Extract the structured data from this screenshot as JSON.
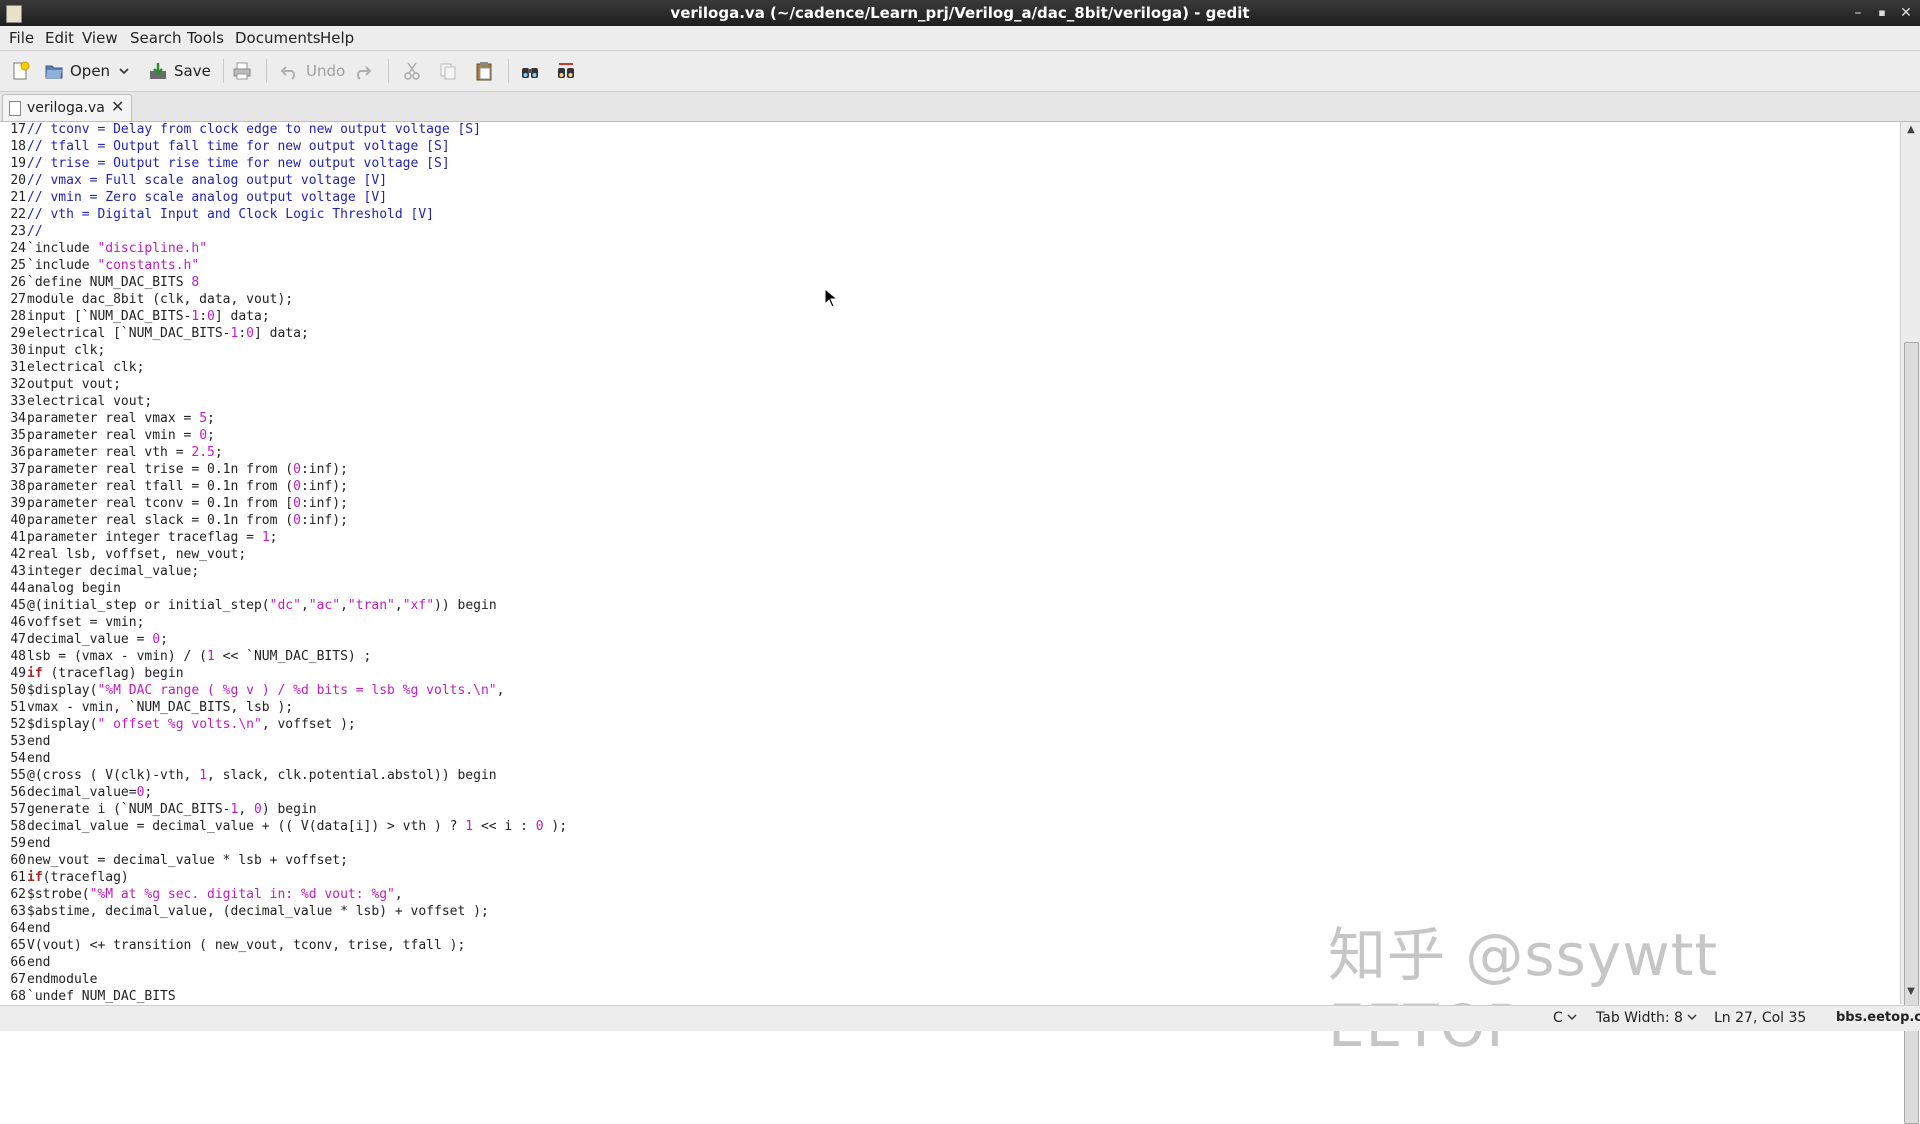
{
  "window": {
    "title": "veriloga.va (~/cadence/Learn_prj/Verilog_a/dac_8bit/veriloga) - gedit"
  },
  "menu": [
    "File",
    "Edit",
    "View",
    "Search",
    "Tools",
    "Documents",
    "Help"
  ],
  "toolbar": {
    "open": "Open",
    "save": "Save",
    "undo": "Undo"
  },
  "tab": {
    "label": "veriloga.va"
  },
  "code_lines": [
    {
      "n": "17",
      "segs": [
        {
          "t": "// tconv = Delay from clock edge to new output voltage [S]",
          "c": "cm"
        }
      ]
    },
    {
      "n": "18",
      "segs": [
        {
          "t": "// tfall = Output fall time for new output voltage [S]",
          "c": "cm"
        }
      ]
    },
    {
      "n": "19",
      "segs": [
        {
          "t": "// trise = Output rise time for new output voltage [S]",
          "c": "cm"
        }
      ]
    },
    {
      "n": "20",
      "segs": [
        {
          "t": "// vmax = Full scale analog output voltage [V]",
          "c": "cm"
        }
      ]
    },
    {
      "n": "21",
      "segs": [
        {
          "t": "// vmin = Zero scale analog output voltage [V]",
          "c": "cm"
        }
      ]
    },
    {
      "n": "22",
      "segs": [
        {
          "t": "// vth = Digital Input and Clock Logic Threshold [V]",
          "c": "cm"
        }
      ]
    },
    {
      "n": "23",
      "segs": [
        {
          "t": "//",
          "c": "cm"
        }
      ]
    },
    {
      "n": "24",
      "segs": [
        {
          "t": "`include ",
          "c": ""
        },
        {
          "t": "\"discipline.h\"",
          "c": "st"
        }
      ]
    },
    {
      "n": "25",
      "segs": [
        {
          "t": "`include ",
          "c": ""
        },
        {
          "t": "\"constants.h\"",
          "c": "st"
        }
      ]
    },
    {
      "n": "26",
      "segs": [
        {
          "t": "`define NUM_DAC_BITS ",
          "c": ""
        },
        {
          "t": "8",
          "c": "nm"
        }
      ]
    },
    {
      "n": "27",
      "segs": [
        {
          "t": "module dac_8bit (clk, data, vout);",
          "c": ""
        }
      ]
    },
    {
      "n": "28",
      "segs": [
        {
          "t": "input [`NUM_DAC_BITS-",
          "c": ""
        },
        {
          "t": "1",
          "c": "nm"
        },
        {
          "t": ":",
          "c": ""
        },
        {
          "t": "0",
          "c": "nm"
        },
        {
          "t": "] data;",
          "c": ""
        }
      ]
    },
    {
      "n": "29",
      "segs": [
        {
          "t": "electrical [`NUM_DAC_BITS-",
          "c": ""
        },
        {
          "t": "1",
          "c": "nm"
        },
        {
          "t": ":",
          "c": ""
        },
        {
          "t": "0",
          "c": "nm"
        },
        {
          "t": "] data;",
          "c": ""
        }
      ]
    },
    {
      "n": "30",
      "segs": [
        {
          "t": "input clk;",
          "c": ""
        }
      ]
    },
    {
      "n": "31",
      "segs": [
        {
          "t": "electrical clk;",
          "c": ""
        }
      ]
    },
    {
      "n": "32",
      "segs": [
        {
          "t": "output vout;",
          "c": ""
        }
      ]
    },
    {
      "n": "33",
      "segs": [
        {
          "t": "electrical vout;",
          "c": ""
        }
      ]
    },
    {
      "n": "34",
      "segs": [
        {
          "t": "parameter real vmax = ",
          "c": ""
        },
        {
          "t": "5",
          "c": "nm"
        },
        {
          "t": ";",
          "c": ""
        }
      ]
    },
    {
      "n": "35",
      "segs": [
        {
          "t": "parameter real vmin = ",
          "c": ""
        },
        {
          "t": "0",
          "c": "nm"
        },
        {
          "t": ";",
          "c": ""
        }
      ]
    },
    {
      "n": "36",
      "segs": [
        {
          "t": "parameter real vth = ",
          "c": ""
        },
        {
          "t": "2.5",
          "c": "nm"
        },
        {
          "t": ";",
          "c": ""
        }
      ]
    },
    {
      "n": "37",
      "segs": [
        {
          "t": "parameter real trise = 0.1n from (",
          "c": ""
        },
        {
          "t": "0",
          "c": "nm"
        },
        {
          "t": ":inf);",
          "c": ""
        }
      ]
    },
    {
      "n": "38",
      "segs": [
        {
          "t": "parameter real tfall = 0.1n from (",
          "c": ""
        },
        {
          "t": "0",
          "c": "nm"
        },
        {
          "t": ":inf);",
          "c": ""
        }
      ]
    },
    {
      "n": "39",
      "segs": [
        {
          "t": "parameter real tconv = 0.1n from [",
          "c": ""
        },
        {
          "t": "0",
          "c": "nm"
        },
        {
          "t": ":inf);",
          "c": ""
        }
      ]
    },
    {
      "n": "40",
      "segs": [
        {
          "t": "parameter real slack = 0.1n from (",
          "c": ""
        },
        {
          "t": "0",
          "c": "nm"
        },
        {
          "t": ":inf);",
          "c": ""
        }
      ]
    },
    {
      "n": "41",
      "segs": [
        {
          "t": "parameter integer traceflag = ",
          "c": ""
        },
        {
          "t": "1",
          "c": "nm"
        },
        {
          "t": ";",
          "c": ""
        }
      ]
    },
    {
      "n": "42",
      "segs": [
        {
          "t": "real lsb, voffset, new_vout;",
          "c": ""
        }
      ]
    },
    {
      "n": "43",
      "segs": [
        {
          "t": "integer decimal_value;",
          "c": ""
        }
      ]
    },
    {
      "n": "44",
      "segs": [
        {
          "t": "analog begin",
          "c": ""
        }
      ]
    },
    {
      "n": "45",
      "segs": [
        {
          "t": "@(initial_step or initial_step(",
          "c": ""
        },
        {
          "t": "\"dc\"",
          "c": "st"
        },
        {
          "t": ",",
          "c": ""
        },
        {
          "t": "\"ac\"",
          "c": "st"
        },
        {
          "t": ",",
          "c": ""
        },
        {
          "t": "\"tran\"",
          "c": "st"
        },
        {
          "t": ",",
          "c": ""
        },
        {
          "t": "\"xf\"",
          "c": "st"
        },
        {
          "t": ")) begin",
          "c": ""
        }
      ]
    },
    {
      "n": "46",
      "segs": [
        {
          "t": "voffset = vmin;",
          "c": ""
        }
      ]
    },
    {
      "n": "47",
      "segs": [
        {
          "t": "decimal_value = ",
          "c": ""
        },
        {
          "t": "0",
          "c": "nm"
        },
        {
          "t": ";",
          "c": ""
        }
      ]
    },
    {
      "n": "48",
      "segs": [
        {
          "t": "lsb = (vmax - vmin) / (",
          "c": ""
        },
        {
          "t": "1",
          "c": "nm"
        },
        {
          "t": " << `NUM_DAC_BITS) ;",
          "c": ""
        }
      ]
    },
    {
      "n": "49",
      "segs": [
        {
          "t": "if",
          "c": "kw"
        },
        {
          "t": " (traceflag) begin",
          "c": ""
        }
      ]
    },
    {
      "n": "50",
      "segs": [
        {
          "t": "$display(",
          "c": ""
        },
        {
          "t": "\"%M DAC range ( %g v ) / %d bits = lsb %g volts.\\n\"",
          "c": "st"
        },
        {
          "t": ",",
          "c": ""
        }
      ]
    },
    {
      "n": "51",
      "segs": [
        {
          "t": "vmax - vmin, `NUM_DAC_BITS, lsb );",
          "c": ""
        }
      ]
    },
    {
      "n": "52",
      "segs": [
        {
          "t": "$display(",
          "c": ""
        },
        {
          "t": "\" offset %g volts.\\n\"",
          "c": "st"
        },
        {
          "t": ", voffset );",
          "c": ""
        }
      ]
    },
    {
      "n": "53",
      "segs": [
        {
          "t": "end",
          "c": ""
        }
      ]
    },
    {
      "n": "54",
      "segs": [
        {
          "t": "end",
          "c": ""
        }
      ]
    },
    {
      "n": "55",
      "segs": [
        {
          "t": "@(cross ( V(clk)-vth, ",
          "c": ""
        },
        {
          "t": "1",
          "c": "nm"
        },
        {
          "t": ", slack, clk.potential.abstol)) begin",
          "c": ""
        }
      ]
    },
    {
      "n": "56",
      "segs": [
        {
          "t": "decimal_value=",
          "c": ""
        },
        {
          "t": "0",
          "c": "nm"
        },
        {
          "t": ";",
          "c": ""
        }
      ]
    },
    {
      "n": "57",
      "segs": [
        {
          "t": "generate i (`NUM_DAC_BITS-",
          "c": ""
        },
        {
          "t": "1",
          "c": "nm"
        },
        {
          "t": ", ",
          "c": ""
        },
        {
          "t": "0",
          "c": "nm"
        },
        {
          "t": ") begin",
          "c": ""
        }
      ]
    },
    {
      "n": "58",
      "segs": [
        {
          "t": "decimal_value = decimal_value + (( V(data[i]) > vth ) ? ",
          "c": ""
        },
        {
          "t": "1",
          "c": "nm"
        },
        {
          "t": " << i : ",
          "c": ""
        },
        {
          "t": "0",
          "c": "nm"
        },
        {
          "t": " );",
          "c": ""
        }
      ]
    },
    {
      "n": "59",
      "segs": [
        {
          "t": "end",
          "c": ""
        }
      ]
    },
    {
      "n": "60",
      "segs": [
        {
          "t": "new_vout = decimal_value * lsb + voffset;",
          "c": ""
        }
      ]
    },
    {
      "n": "61",
      "segs": [
        {
          "t": "if",
          "c": "kw"
        },
        {
          "t": "(traceflag)",
          "c": ""
        }
      ]
    },
    {
      "n": "62",
      "segs": [
        {
          "t": "$strobe(",
          "c": ""
        },
        {
          "t": "\"%M at %g sec. digital in: %d vout: %g\"",
          "c": "st"
        },
        {
          "t": ",",
          "c": ""
        }
      ]
    },
    {
      "n": "63",
      "segs": [
        {
          "t": "$abstime, decimal_value, (decimal_value * lsb) + voffset );",
          "c": ""
        }
      ]
    },
    {
      "n": "64",
      "segs": [
        {
          "t": "end",
          "c": ""
        }
      ]
    },
    {
      "n": "65",
      "segs": [
        {
          "t": "V(vout) <+ transition ( new_vout, tconv, trise, tfall );",
          "c": ""
        }
      ]
    },
    {
      "n": "66",
      "segs": [
        {
          "t": "end",
          "c": ""
        }
      ]
    },
    {
      "n": "67",
      "segs": [
        {
          "t": "endmodule",
          "c": ""
        }
      ]
    },
    {
      "n": "68",
      "segs": [
        {
          "t": "`undef NUM_DAC_BITS",
          "c": ""
        }
      ]
    }
  ],
  "status": {
    "language": "C",
    "tab_width": "Tab Width: 8",
    "position": "Ln 27, Col 35",
    "site": "bbs.eetop.cn"
  },
  "watermark": "知乎 @ssywtt EETOP"
}
